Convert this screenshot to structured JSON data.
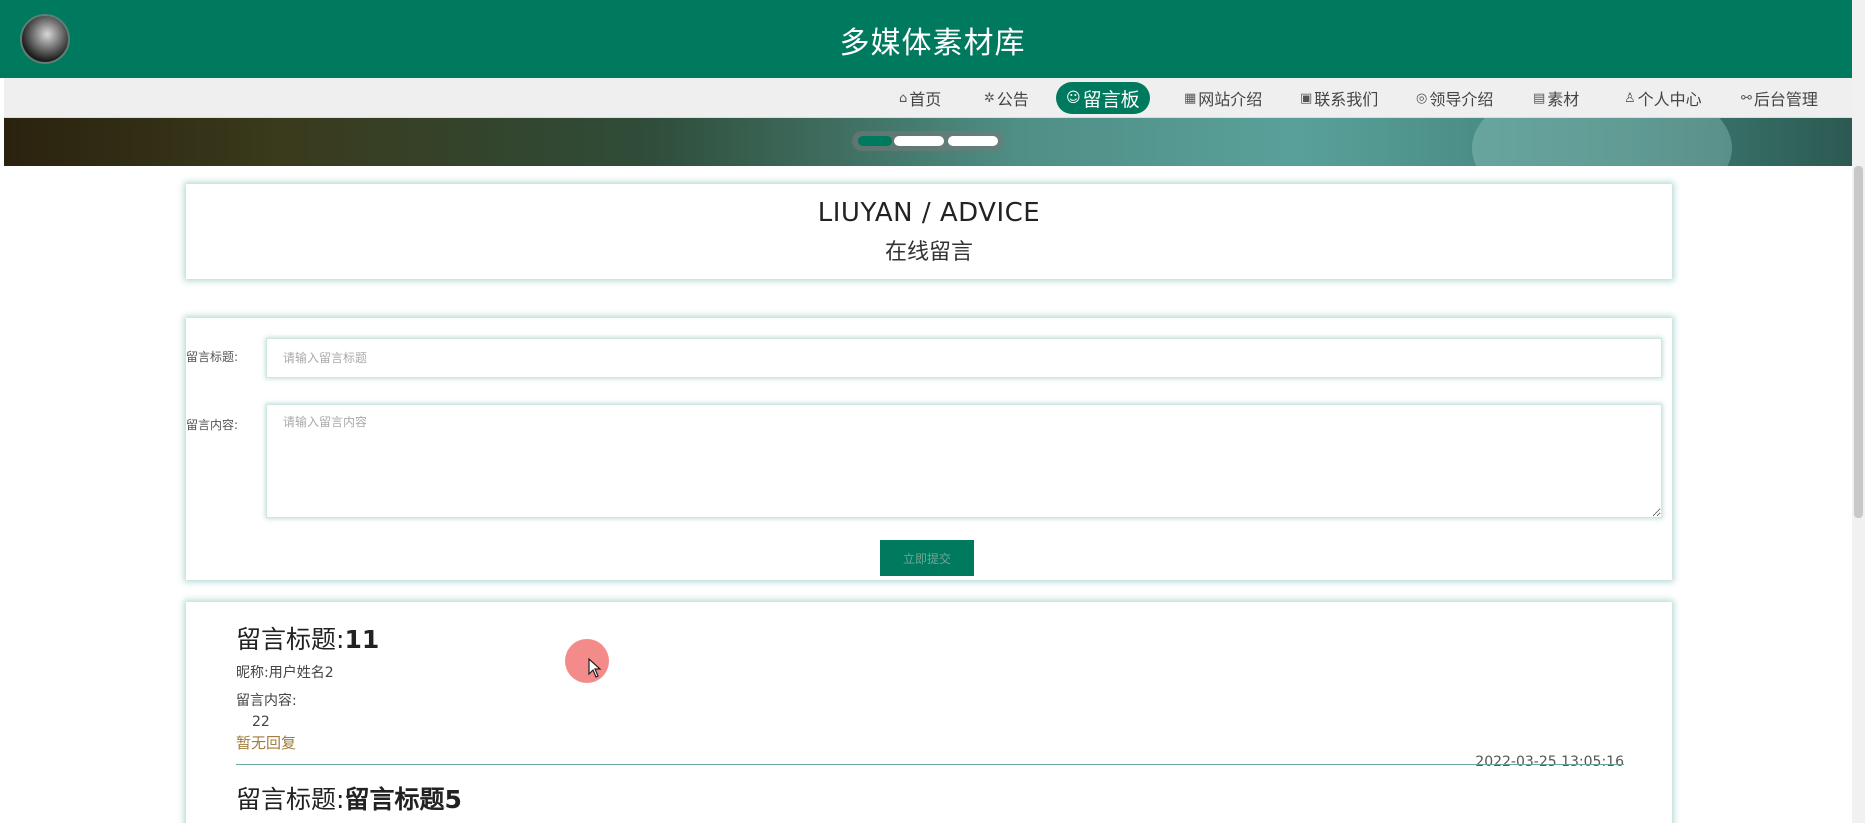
{
  "header": {
    "site_title": "多媒体素材库",
    "brand_color": "#007a5e"
  },
  "nav": {
    "items": [
      {
        "icon": "home-icon",
        "glyph": "⌂",
        "label": "首页"
      },
      {
        "icon": "announcement-icon",
        "glyph": "✲",
        "label": "公告"
      },
      {
        "icon": "message-board-icon",
        "glyph": "☺",
        "label": "留言板",
        "active": true
      },
      {
        "icon": "website-icon",
        "glyph": "▦",
        "label": "网站介绍"
      },
      {
        "icon": "contact-icon",
        "glyph": "▣",
        "label": "联系我们"
      },
      {
        "icon": "leader-icon",
        "glyph": "◎",
        "label": "领导介绍"
      },
      {
        "icon": "material-icon",
        "glyph": "▤",
        "label": "素材"
      },
      {
        "icon": "user-icon",
        "glyph": "♙",
        "label": "个人中心"
      },
      {
        "icon": "link-icon",
        "glyph": "⚯",
        "label": "后台管理"
      }
    ]
  },
  "page_heading": {
    "en": "LIUYAN / ADVICE",
    "cn": "在线留言"
  },
  "form": {
    "title_label": "留言标题:",
    "title_placeholder": "请输入留言标题",
    "content_label": "留言内容:",
    "content_placeholder": "请输入留言内容",
    "submit_label": "立即提交"
  },
  "messages": [
    {
      "title_prefix": "留言标题:",
      "title": "11",
      "nickname_line": "昵称:用户姓名2",
      "content_label": "留言内容:",
      "content": "22",
      "reply": "暂无回复",
      "time": "2022-03-25 13:05:16"
    },
    {
      "title_prefix": "留言标题:",
      "title": "留言标题5"
    }
  ]
}
